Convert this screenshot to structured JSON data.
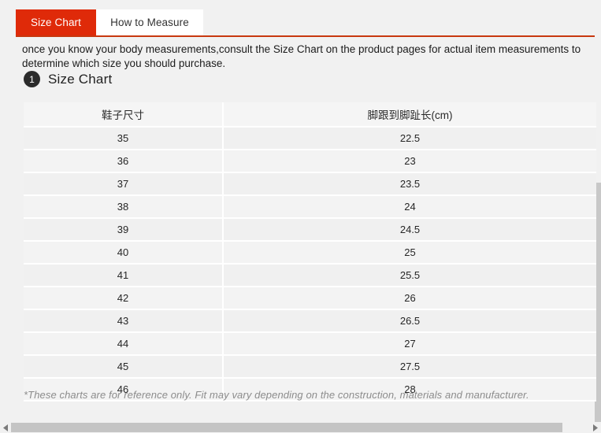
{
  "tabs": [
    {
      "label": "Size Chart",
      "active": true
    },
    {
      "label": "How to Measure",
      "active": false
    }
  ],
  "intro": {
    "text": "once you know your body measurements,consult the Size Chart on the product pages for actual item measurements to determine which size you should purchase."
  },
  "section": {
    "badge": "1",
    "title": "Size Chart"
  },
  "chart_data": {
    "type": "table",
    "title": "Size Chart",
    "columns": [
      "鞋子尺寸",
      "脚跟到脚趾长(cm)"
    ],
    "rows": [
      [
        "35",
        "22.5"
      ],
      [
        "36",
        "23"
      ],
      [
        "37",
        "23.5"
      ],
      [
        "38",
        "24"
      ],
      [
        "39",
        "24.5"
      ],
      [
        "40",
        "25"
      ],
      [
        "41",
        "25.5"
      ],
      [
        "42",
        "26"
      ],
      [
        "43",
        "26.5"
      ],
      [
        "44",
        "27"
      ],
      [
        "45",
        "27.5"
      ],
      [
        "46",
        "28"
      ]
    ]
  },
  "footnote": {
    "text": "*These charts are for reference only. Fit may vary depending on the construction, materials and manufacturer."
  },
  "colors": {
    "accent_red": "#df2a09",
    "rule_red": "#c8380f",
    "badge_dark": "#2b2b2b",
    "row_odd": "#f0f0f0",
    "row_even": "#f3f3f3",
    "header_bg": "#f5f5f5",
    "page_bg": "#f1f1f1"
  },
  "scrollbars": {
    "horizontal_left_arrow": "triangle-left-icon",
    "horizontal_right_arrow": "triangle-right-icon"
  }
}
